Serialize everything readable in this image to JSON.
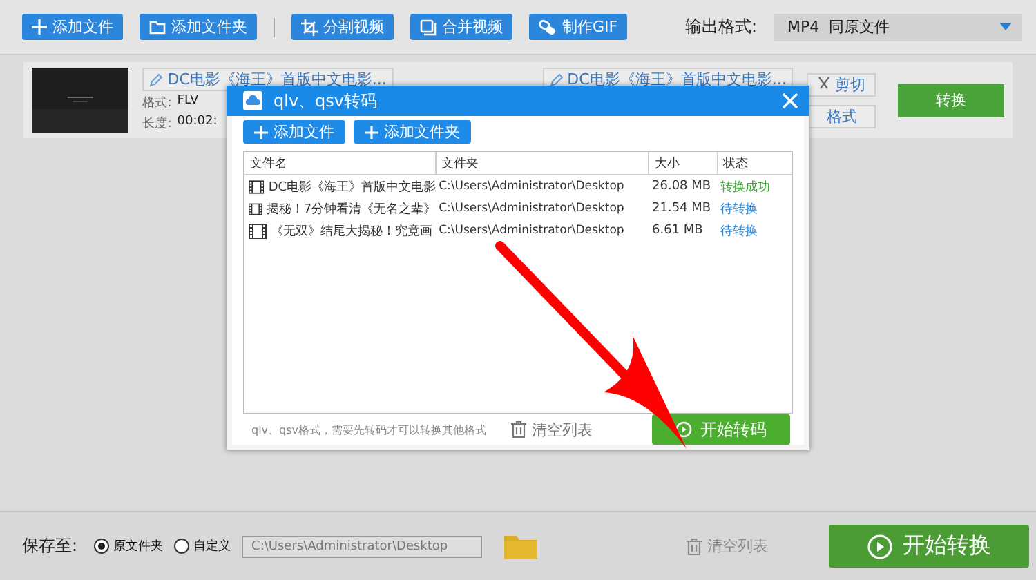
{
  "toolbar": {
    "buttons": [
      {
        "label": "添加文件"
      },
      {
        "label": "添加文件夹"
      },
      {
        "label": "分割视频"
      },
      {
        "label": "合并视频"
      },
      {
        "label": "制作GIF"
      }
    ],
    "output_format": {
      "label": "输出格式:",
      "value": "MP4  同原文件"
    }
  },
  "file_item": {
    "source_name": "DC电影《海王》首版中文电影...",
    "format_label": "格式:",
    "format_value": "FLV",
    "length_label": "长度:",
    "length_value": "00:02:",
    "target_name": "DC电影《海王》首版中文电影...",
    "cut_label": "剪切",
    "format_button": "格式",
    "convert_label": "转换"
  },
  "dialog": {
    "title": "qlv、qsv转码",
    "buttons": [
      "添加文件",
      "添加文件夹"
    ],
    "columns": [
      "文件名",
      "文件夹",
      "大小",
      "状态"
    ],
    "rows": [
      {
        "name": "DC电影《海王》首版中文电影",
        "folder": "C:\\Users\\Administrator\\Desktop",
        "size": "26.08 MB",
        "status": "转换成功",
        "color": "#3aa935"
      },
      {
        "name": "揭秘！7分钟看清《无名之辈》",
        "folder": "C:\\Users\\Administrator\\Desktop",
        "size": "21.54 MB",
        "status": "待转换",
        "color": "#2a8ae0"
      },
      {
        "name": "《无双》结尾大揭秘！究竟画",
        "folder": "C:\\Users\\Administrator\\Desktop",
        "size": "6.61 MB",
        "status": "待转换",
        "color": "#2a8ae0"
      }
    ],
    "hint": "qlv、qsv格式，需要先转码才可以转换其他格式",
    "clear_label": "清空列表",
    "start_label": "开始转码"
  },
  "bottom": {
    "save_label": "保存至:",
    "options": [
      {
        "label": "原文件夹",
        "selected": true
      },
      {
        "label": "自定义",
        "selected": false
      }
    ],
    "path": "C:\\Users\\Administrator\\Desktop",
    "clear_label": "清空列表",
    "start_label": "开始转换"
  }
}
